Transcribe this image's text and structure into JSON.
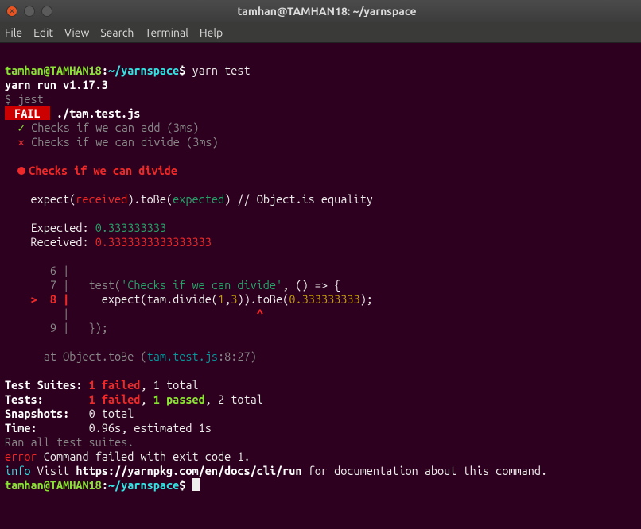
{
  "titlebar": {
    "title": "tamhan@TAMHAN18: ~/yarnspace"
  },
  "menu": {
    "file": "File",
    "edit": "Edit",
    "view": "View",
    "search": "Search",
    "terminal": "Terminal",
    "help": "Help"
  },
  "prompt": {
    "userhost": "tamhan@TAMHAN18",
    "sep": ":",
    "path": "~/yarnspace",
    "dollar": "$"
  },
  "cmd": {
    "yarn_test": "yarn test"
  },
  "run": {
    "version_line": "yarn run v1.17.3",
    "jest_line": "$ jest"
  },
  "badge": {
    "fail": " FAIL "
  },
  "suite": {
    "file": "./tam.test.js"
  },
  "checks": {
    "pass": "Checks if we can add (3ms)",
    "passmark": "✓",
    "fail": "Checks if we can divide (3ms)",
    "failmark": "✕",
    "fail_header": "Checks if we can divide"
  },
  "expect": {
    "prefix": "    expect(",
    "received": "received",
    "mid": ").",
    "toBe": "toBe",
    "open": "(",
    "expected": "expected",
    "close": ") // Object.is equality",
    "exp_label": "    Expected: ",
    "exp_val": "0.333333333",
    "rec_label": "    Received: ",
    "rec_val": "0.3333333333333333"
  },
  "code": {
    "l6": "       6 |",
    "l7a": "       7 |   test(",
    "l7b": "'Checks if we can divide'",
    "l7c": ", () => {",
    "l8p": "    >  8 |",
    "l8a": "     expect(tam.",
    "l8b": "divide",
    "l8c": "(",
    "l8d": "1",
    "l8e": ",",
    "l8f": "3",
    "l8g": ")).",
    "l8h": "toBe",
    "l8i": "(",
    "l8j": "0.333333333",
    "l8k": ");",
    "caret": "         |                             ",
    "caret_sym": "^",
    "l9a": "       9 |   });"
  },
  "stack": {
    "at": "      at Object.toBe (",
    "file": "tam.test.js",
    "loc": ":8:27)"
  },
  "summary": {
    "suites_label": "Test Suites: ",
    "suites_fail": "1 failed",
    "suites_rest": ", 1 total",
    "tests_label": "Tests:       ",
    "tests_fail": "1 failed",
    "tests_mid": ", ",
    "tests_pass": "1 passed",
    "tests_rest": ", 2 total",
    "snap_label": "Snapshots:   ",
    "snap_val": "0 total",
    "time_label": "Time:        ",
    "time_val": "0.96s, estimated 1s",
    "ran": "Ran all test suites."
  },
  "footer": {
    "error": "error",
    "error_msg": " Command failed with exit code 1.",
    "info": "info",
    "info_a": " Visit ",
    "info_url": "https://yarnpkg.com/en/docs/cli/run",
    "info_b": " for documentation about this command."
  }
}
